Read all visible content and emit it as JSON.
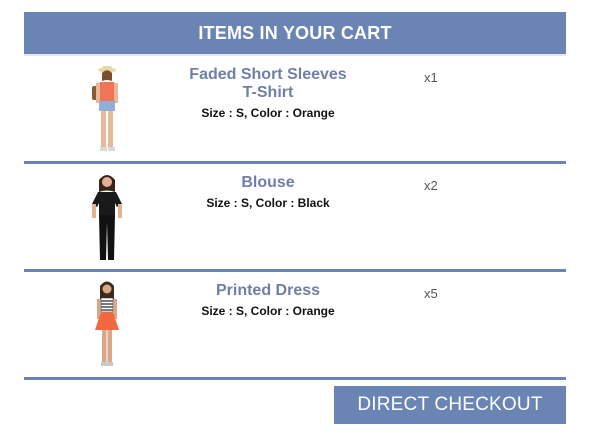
{
  "cart": {
    "title": "ITEMS IN YOUR CART",
    "items": [
      {
        "name_line1": "Faded Short Sleeves",
        "name_line2": "T-Shirt",
        "attributes": "Size : S, Color : Orange",
        "quantity": "x1",
        "image": "model-orange-top-shorts"
      },
      {
        "name_line1": "Blouse",
        "name_line2": "",
        "attributes": "Size : S, Color : Black",
        "quantity": "x2",
        "image": "model-black-blouse"
      },
      {
        "name_line1": "Printed Dress",
        "name_line2": "",
        "attributes": "Size : S, Color : Orange",
        "quantity": "x5",
        "image": "model-orange-dress"
      }
    ],
    "checkout_label": "DIRECT CHECKOUT"
  },
  "colors": {
    "accent": "#6a84b4",
    "product_name": "#6f7fa6"
  }
}
